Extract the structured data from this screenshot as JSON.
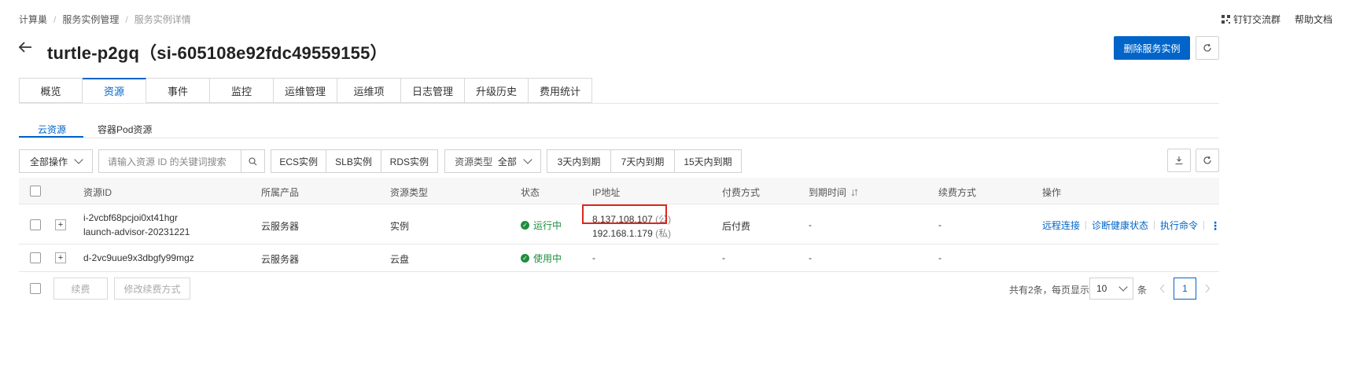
{
  "breadcrumb": [
    "计算巢",
    "服务实例管理",
    "服务实例详情"
  ],
  "top_links": [
    "钉钉交流群",
    "帮助文档"
  ],
  "title": "turtle-p2gq（si-605108e92fdc49559155）",
  "delete_button": "删除服务实例",
  "tabs": [
    "概览",
    "资源",
    "事件",
    "监控",
    "运维管理",
    "运维项",
    "日志管理",
    "升级历史",
    "费用统计"
  ],
  "active_tab": "资源",
  "subtabs": [
    "云资源",
    "容器Pod资源"
  ],
  "toolbar": {
    "bulk_action": "全部操作",
    "search_placeholder": "请输入资源 ID 的关键词搜索",
    "filters": [
      "ECS实例",
      "SLB实例",
      "RDS实例"
    ],
    "resource_type_label": "资源类型",
    "resource_type_value": "全部",
    "expiry_filters": [
      "3天内到期",
      "7天内到期",
      "15天内到期"
    ]
  },
  "table": {
    "headers": [
      "资源ID",
      "所属产品",
      "资源类型",
      "状态",
      "IP地址",
      "付费方式",
      "到期时间",
      "续费方式",
      "操作"
    ],
    "rows": [
      {
        "id": "i-2vcbf68pcjoi0xt41hgr",
        "name": "launch-advisor-20231221",
        "product": "云服务器",
        "type": "实例",
        "status": "运行中",
        "ip_public": "8.137.108.107",
        "ip_public_tag": "(公)",
        "ip_private": "192.168.1.179",
        "ip_private_tag": "(私)",
        "billing": "后付费",
        "expiry": "-",
        "renew": "-",
        "actions": [
          "远程连接",
          "诊断健康状态",
          "执行命令"
        ]
      },
      {
        "id": "d-2vc9uue9x3dbgfy99mgz",
        "product": "云服务器",
        "type": "云盘",
        "status": "使用中",
        "ip": "-",
        "billing": "-",
        "expiry": "-",
        "renew": "-"
      }
    ]
  },
  "footer": {
    "renew_button": "续费",
    "change_renew_button": "修改续费方式",
    "total_text": "共有2条，",
    "per_page_label": "每页显示",
    "per_page_value": "10",
    "per_page_unit": "条",
    "current_page": "1"
  },
  "colors": {
    "primary": "#0064c8",
    "success": "#1e8e3e",
    "highlight": "#e1251b"
  }
}
